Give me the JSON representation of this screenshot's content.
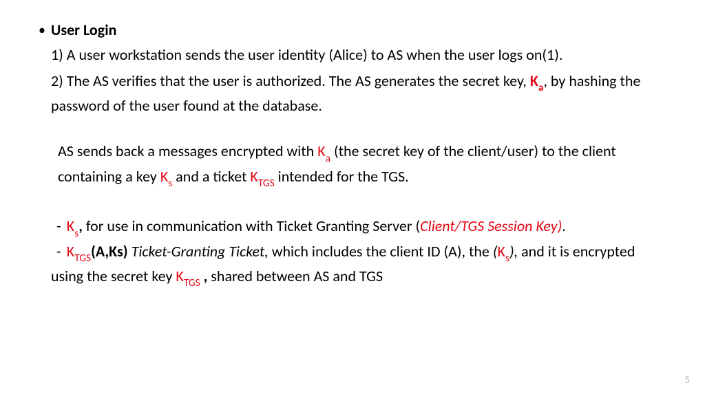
{
  "slide": {
    "heading": "User Login",
    "para1": "1) A user workstation sends the user identity (Alice) to AS when the user logs on(1).",
    "para2_a": "2) The AS verifies that the user is authorized. The AS generates the secret key, ",
    "key_K": "K",
    "key_a": "a",
    "para2_b": ", by hashing the password of the user found at the database.",
    "block_as_a": "AS sends back  a messages encrypted with ",
    "k_label": "K",
    "sub_a": "a",
    "block_as_b": " (the secret key of the client/user) to the client containing a key ",
    "sub_s": "s",
    "block_as_c": "   and a ticket ",
    "sub_tgs": "TGS",
    "block_as_d": " intended for  the TGS.",
    "li1_a": ",",
    "li1_b": " for use in communication with Ticket Granting Server (",
    "li1_c": "Client/TGS Session Key)",
    "li1_d": ".",
    "li2_a": "(A,Ks)",
    "li2_b": " Ticket-Granting Ticket,",
    "li2_c": " which includes the client ID (A), the  ",
    "li2_open": "(",
    "li2_close": "),",
    "li2_d": " and it is encrypted using the secret key ",
    "li2_e": " ,",
    "li2_f": " shared between AS and TGS",
    "dash": "-",
    "bullet": "•",
    "page_number": "5"
  }
}
